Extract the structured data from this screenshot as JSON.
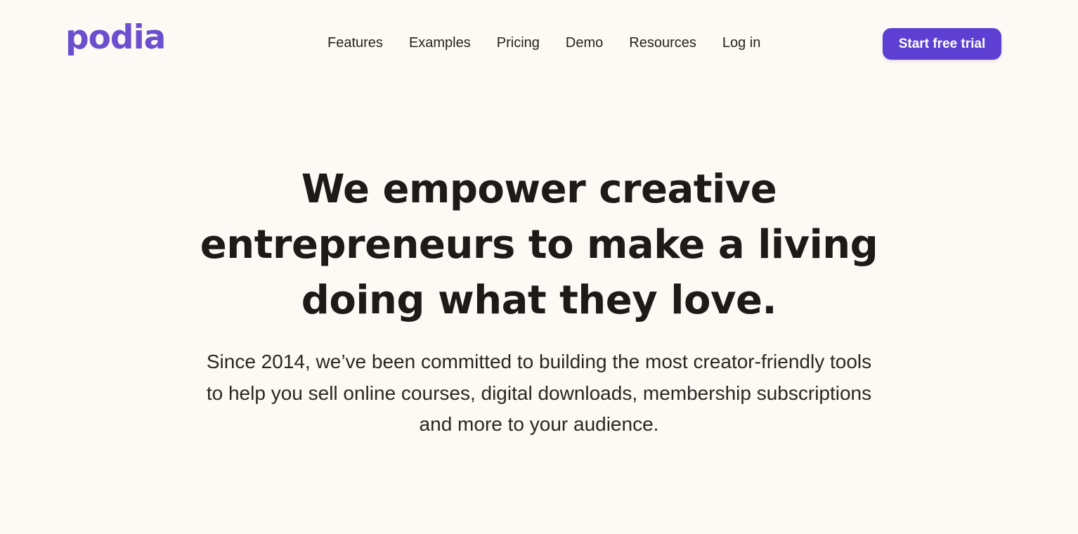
{
  "header": {
    "logo_text": "podia",
    "nav": [
      {
        "label": "Features"
      },
      {
        "label": "Examples"
      },
      {
        "label": "Pricing"
      },
      {
        "label": "Demo"
      },
      {
        "label": "Resources"
      },
      {
        "label": "Log in"
      }
    ],
    "cta_label": "Start free trial"
  },
  "hero": {
    "title": "We empower creative entrepreneurs to make a living doing what they love.",
    "subtitle": "Since 2014, we’ve been committed to building the most creator-friendly tools to help you sell online courses, digital downloads, membership subscriptions and more to your audience."
  },
  "colors": {
    "background": "#fdf9f4",
    "brand": "#6b4fcf",
    "cta_background": "#5d3fd3",
    "cta_text": "#ffffff",
    "text": "#1d1a17"
  }
}
